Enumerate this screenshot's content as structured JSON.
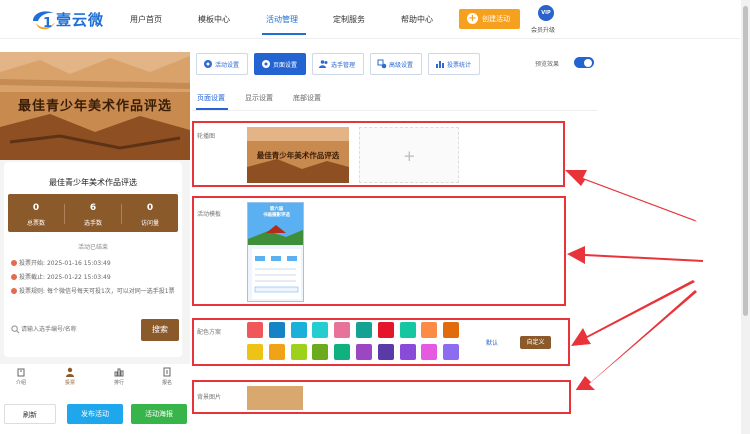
{
  "brand": {
    "name": "壹云微",
    "logo_digit": "1"
  },
  "nav": {
    "items": [
      {
        "label": "用户首页"
      },
      {
        "label": "模板中心"
      },
      {
        "label": "活动管理"
      },
      {
        "label": "定制服务"
      },
      {
        "label": "帮助中心"
      }
    ],
    "active_index": 2,
    "create_label": "创建活动",
    "vip_badge": "VIP",
    "vip_label": "会员升级"
  },
  "preview": {
    "banner_title": "最佳青少年美术作品评选",
    "card_title": "最佳青少年美术作品评选",
    "stats": [
      {
        "value": "0",
        "label": "总票数"
      },
      {
        "value": "6",
        "label": "选手数"
      },
      {
        "value": "0",
        "label": "访问量"
      }
    ],
    "status": "活动已结束",
    "info": [
      {
        "label": "投票开始:",
        "value": "2025-01-16 15:03:49"
      },
      {
        "label": "投票截止:",
        "value": "2025-01-22 15:03:49"
      },
      {
        "label": "投票规则:",
        "value": "每个微信号每天可投1次，可以对同一选手投1票"
      }
    ],
    "search_placeholder": "请输入选手编号/名称",
    "search_button": "搜索",
    "tabs": [
      {
        "label": "介绍",
        "icon": "home-icon"
      },
      {
        "label": "投票",
        "icon": "user-icon"
      },
      {
        "label": "排行",
        "icon": "ranking-icon"
      },
      {
        "label": "报名",
        "icon": "signup-icon"
      }
    ],
    "active_tab": 1
  },
  "bottom_buttons": {
    "refresh": "刷新",
    "publish": "发布活动",
    "poster": "活动海报"
  },
  "toolbar": {
    "buttons": [
      {
        "label": "活动设置",
        "icon": "gear-icon"
      },
      {
        "label": "页面设置",
        "icon": "settings-icon"
      },
      {
        "label": "选手管理",
        "icon": "users-icon"
      },
      {
        "label": "高级设置",
        "icon": "advanced-icon"
      },
      {
        "label": "投票统计",
        "icon": "chart-icon"
      }
    ],
    "active_index": 1,
    "preview_effect_label": "预览效果",
    "preview_effect_on": true
  },
  "subtabs": [
    {
      "label": "页面设置"
    },
    {
      "label": "显示设置"
    },
    {
      "label": "底部设置"
    }
  ],
  "sections": {
    "carousel_label": "轮播图",
    "carousel_text": "最佳青少年美术作品评选",
    "template_label": "活动模板",
    "template_title": "第六届\n书画摄影评选",
    "color_label": "配色方案",
    "colors": [
      "#f0575a",
      "#1683c7",
      "#1bb0d9",
      "#25ccd0",
      "#e8739a",
      "#14a392",
      "#e5162a",
      "#14c7a0",
      "#fb8b45",
      "#e06a0c",
      "#eec315",
      "#f1a318",
      "#9ed11b",
      "#6bab1e",
      "#10b07f",
      "#9b47c4",
      "#5a3aa7",
      "#8b4bd9",
      "#e55ae0",
      "#8c6cf0"
    ],
    "default_label": "默认",
    "custom_label": "自定义",
    "bg_label": "背景图片"
  }
}
